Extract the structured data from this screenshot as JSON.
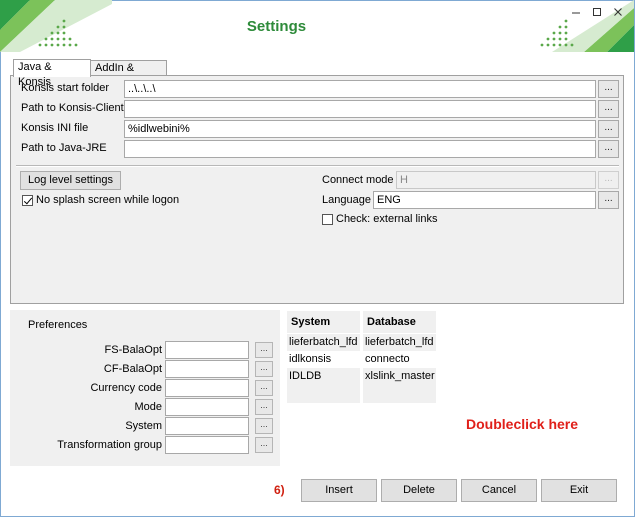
{
  "window": {
    "title": "Settings"
  },
  "tabs": [
    {
      "label": "Java & Konsis"
    },
    {
      "label": "AddIn & Excel"
    }
  ],
  "paths": [
    {
      "label": "Konsis start folder",
      "value": "..\\..\\..\\"
    },
    {
      "label": "Path to Konsis-Client",
      "value": ""
    },
    {
      "label": "Konsis INI file",
      "value": "%idlwebini%"
    },
    {
      "label": "Path to Java-JRE",
      "value": ""
    }
  ],
  "browse_label": "...",
  "log_level_button": "Log level settings",
  "no_splash": {
    "label": "No splash screen while logon",
    "checked": true
  },
  "connect_mode": {
    "label": "Connect mode",
    "value": "H"
  },
  "language": {
    "label": "Language",
    "value": "ENG"
  },
  "external_links": {
    "label": "Check: external links",
    "checked": false
  },
  "preferences": {
    "title": "Preferences",
    "fields": [
      {
        "label": "FS-BalaOpt",
        "value": ""
      },
      {
        "label": "CF-BalaOpt",
        "value": ""
      },
      {
        "label": "Currency code",
        "value": ""
      },
      {
        "label": "Mode",
        "value": ""
      },
      {
        "label": "System",
        "value": ""
      },
      {
        "label": "Transformation group",
        "value": ""
      }
    ]
  },
  "grid": {
    "columns": [
      "System",
      "Database"
    ],
    "rows": [
      [
        "lieferbatch_lfd",
        "lieferbatch_lfd"
      ],
      [
        "idlkonsis",
        "connecto"
      ],
      [
        "IDLDB",
        "xlslink_master"
      ],
      [
        "",
        ""
      ]
    ]
  },
  "hint": "Doubleclick here",
  "step": "6)",
  "buttons": {
    "insert": "Insert",
    "delete": "Delete",
    "cancel": "Cancel",
    "exit": "Exit"
  },
  "colors": {
    "title": "#2e8b3a",
    "hint": "#e0201a",
    "border": "#7fa9d3"
  }
}
